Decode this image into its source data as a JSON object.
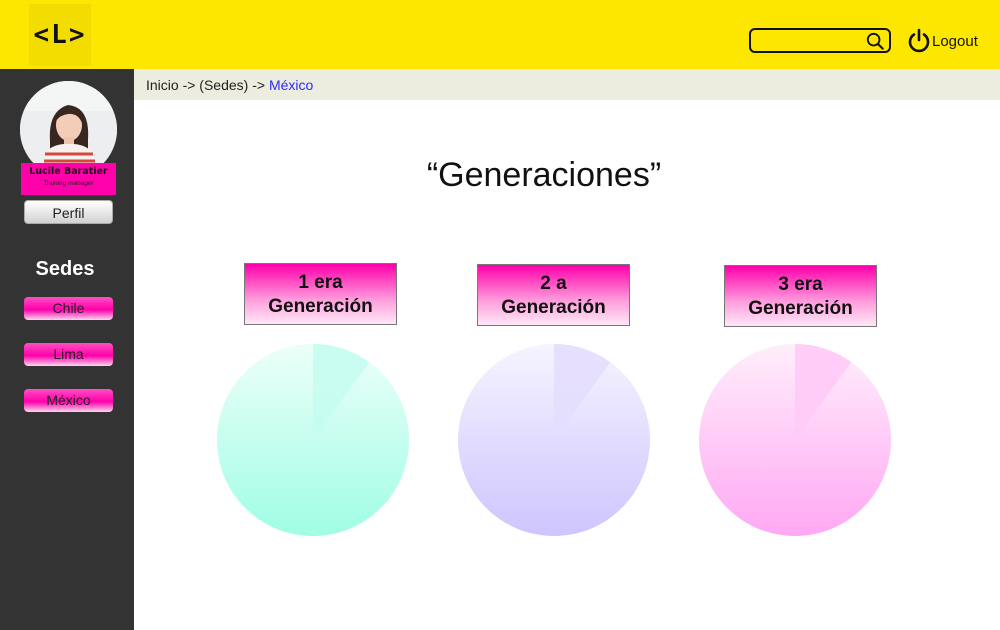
{
  "header": {
    "logo_text": "<L>",
    "search": {
      "placeholder": "",
      "icon": "search-icon"
    },
    "logout_label": "Logout",
    "logout_icon": "power-icon"
  },
  "sidebar": {
    "user": {
      "name": "Lucile Baratier",
      "role": "Training manager",
      "avatar": "avatar-photo"
    },
    "profile_button": "Perfil",
    "sedes_title": "Sedes",
    "sedes": [
      {
        "label": "Chile"
      },
      {
        "label": "Lima"
      },
      {
        "label": "México"
      }
    ]
  },
  "breadcrumb": {
    "prefix": "Inicio -> (Sedes) -> ",
    "current": "México"
  },
  "main": {
    "title": "“Generaciones”",
    "generations": [
      {
        "line1": "1 era",
        "line2": "Generación",
        "color_top": "#ecfff9",
        "color_bottom": "#a0fde4",
        "slice_color": "#c5fdf0",
        "slice_fraction": 0.1
      },
      {
        "line1": "2 a",
        "line2": "Generación",
        "color_top": "#f6f4ff",
        "color_bottom": "#cec5fe",
        "slice_color": "#e4defe",
        "slice_fraction": 0.1
      },
      {
        "line1": "3 era",
        "line2": "Generación",
        "color_top": "#ffeefb",
        "color_bottom": "#ffa8f4",
        "slice_color": "#ffcaf6",
        "slice_fraction": 0.1
      }
    ]
  }
}
